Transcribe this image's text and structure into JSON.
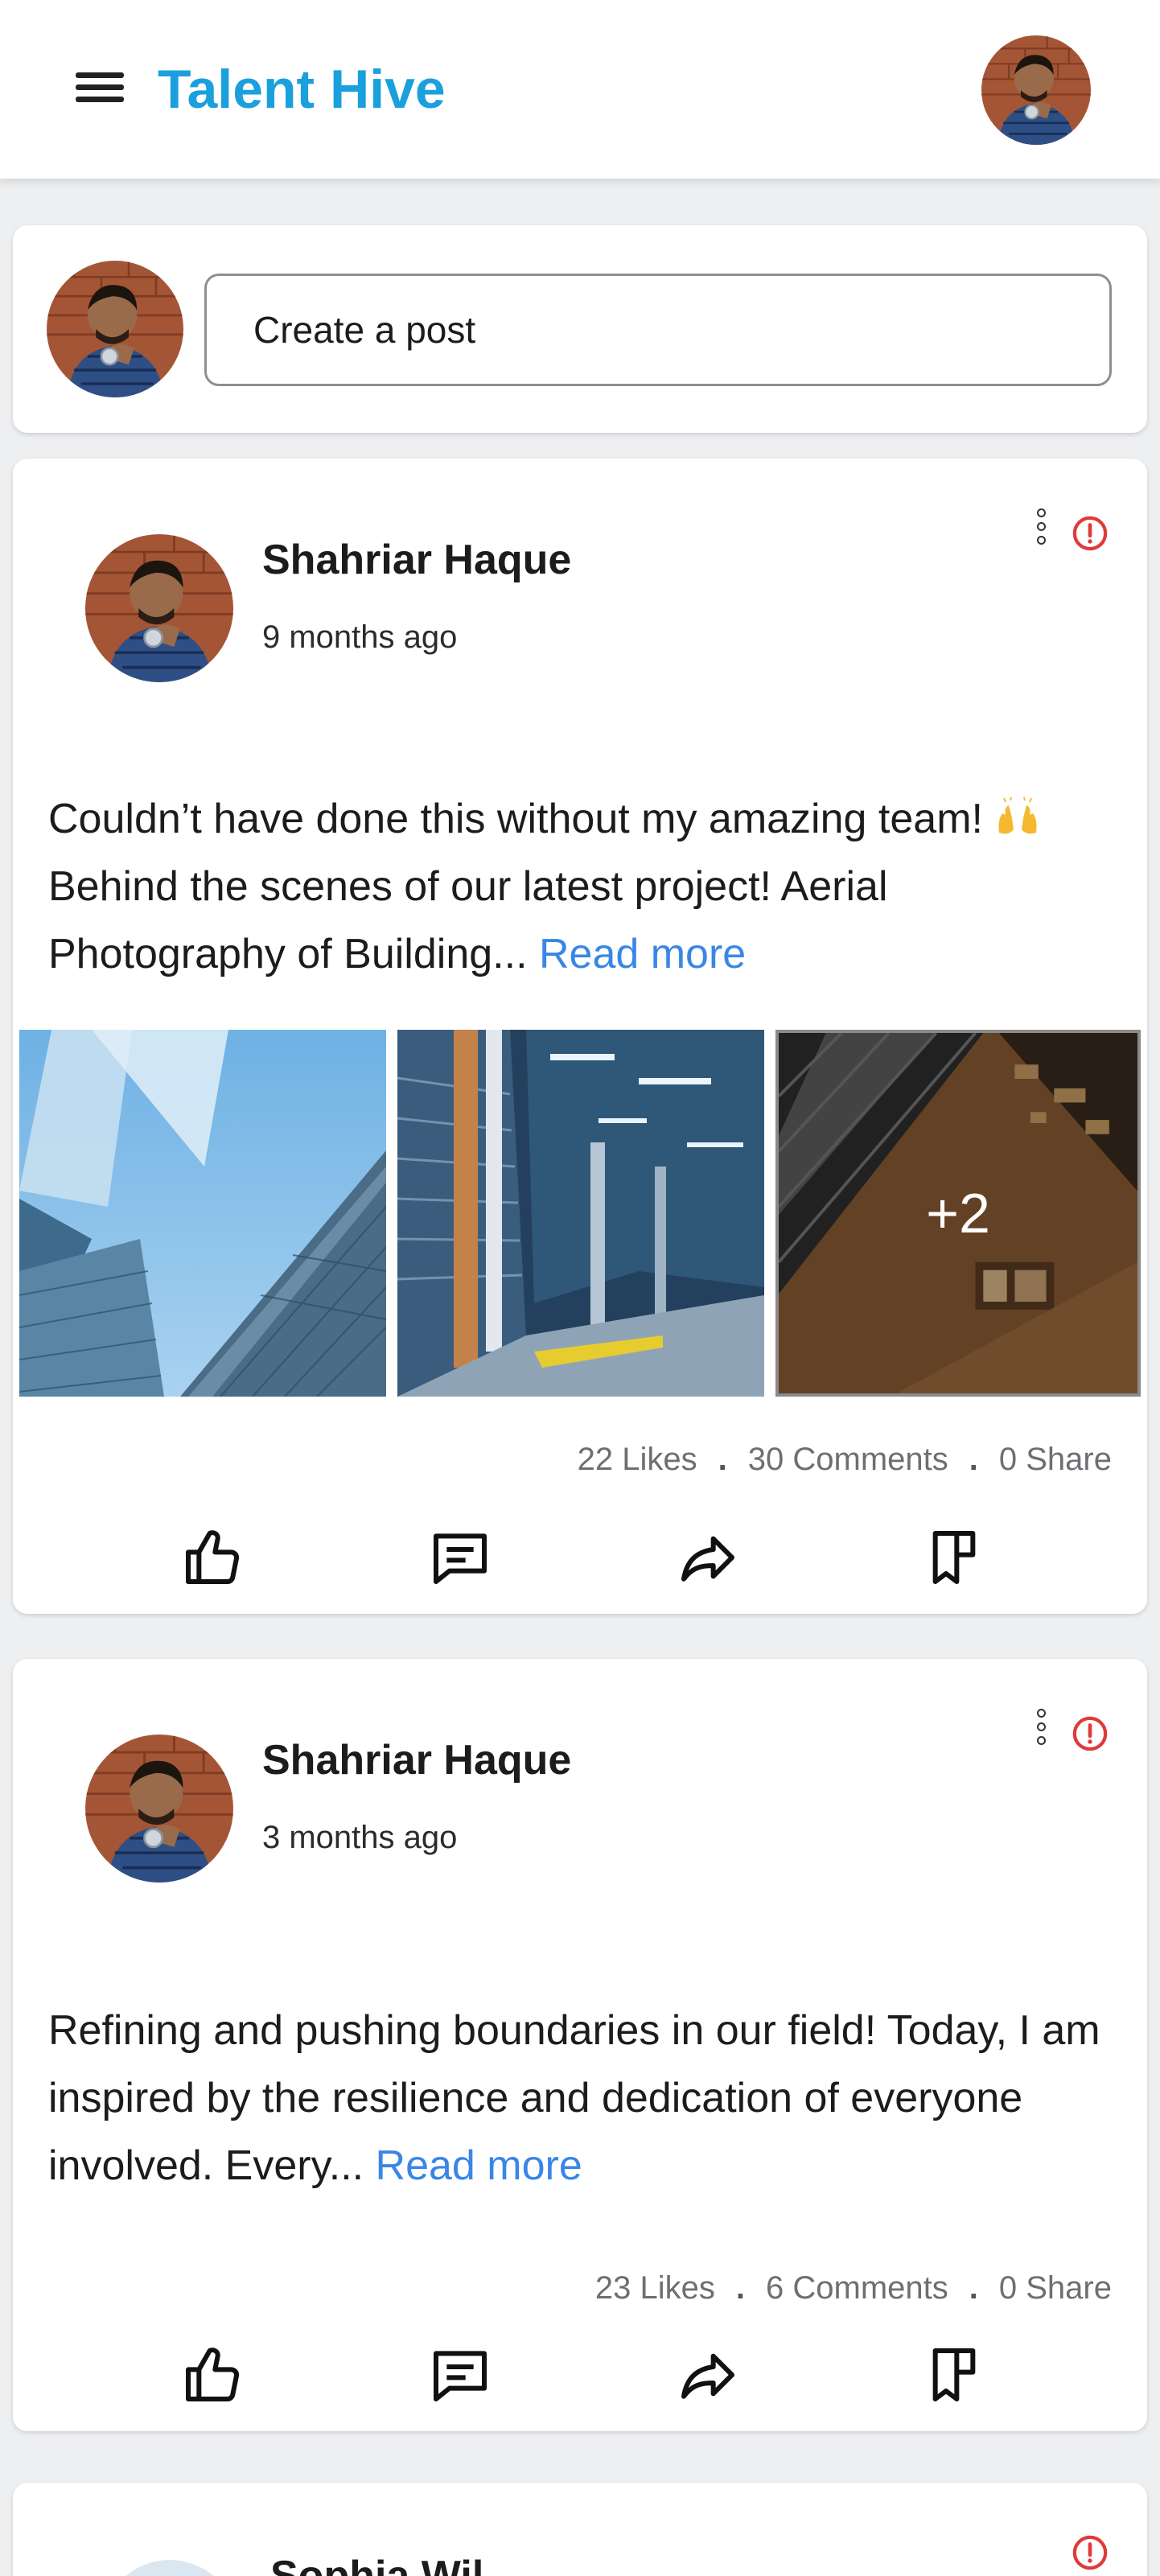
{
  "app": {
    "title": "Talent Hive"
  },
  "composer": {
    "placeholder": "Create a post"
  },
  "posts": [
    {
      "author": "Shahriar Haque",
      "time": "9 months ago",
      "text": "Couldn’t have done this without my amazing team! ",
      "text2": "Behind the scenes of our latest project! Aerial Photography of Building... ",
      "read_more": "Read more",
      "more_images": "+2",
      "likes": "22 Likes",
      "comments": "30 Comments",
      "shares": "0 Share"
    },
    {
      "author": "Shahriar Haque",
      "time": "3 months ago",
      "text": "Refining and pushing boundaries in our field! Today, I am inspired by the resilience and dedication of everyone involved. Every... ",
      "read_more": "Read more",
      "likes": "23 Likes",
      "comments": "6 Comments",
      "shares": "0 Share"
    },
    {
      "author": "Sophia Wil"
    }
  ],
  "separators": {
    "dot": "."
  },
  "icons": {
    "menu": "menu-icon",
    "like": "thumbs-up-icon",
    "comment": "comment-icon",
    "share": "share-icon",
    "save": "bookmark-icon",
    "report": "alert-icon",
    "options": "more-vertical-icon"
  },
  "colors": {
    "brand": "#1aa0dd",
    "link": "#3a86e6",
    "alert": "#e03a3a"
  }
}
